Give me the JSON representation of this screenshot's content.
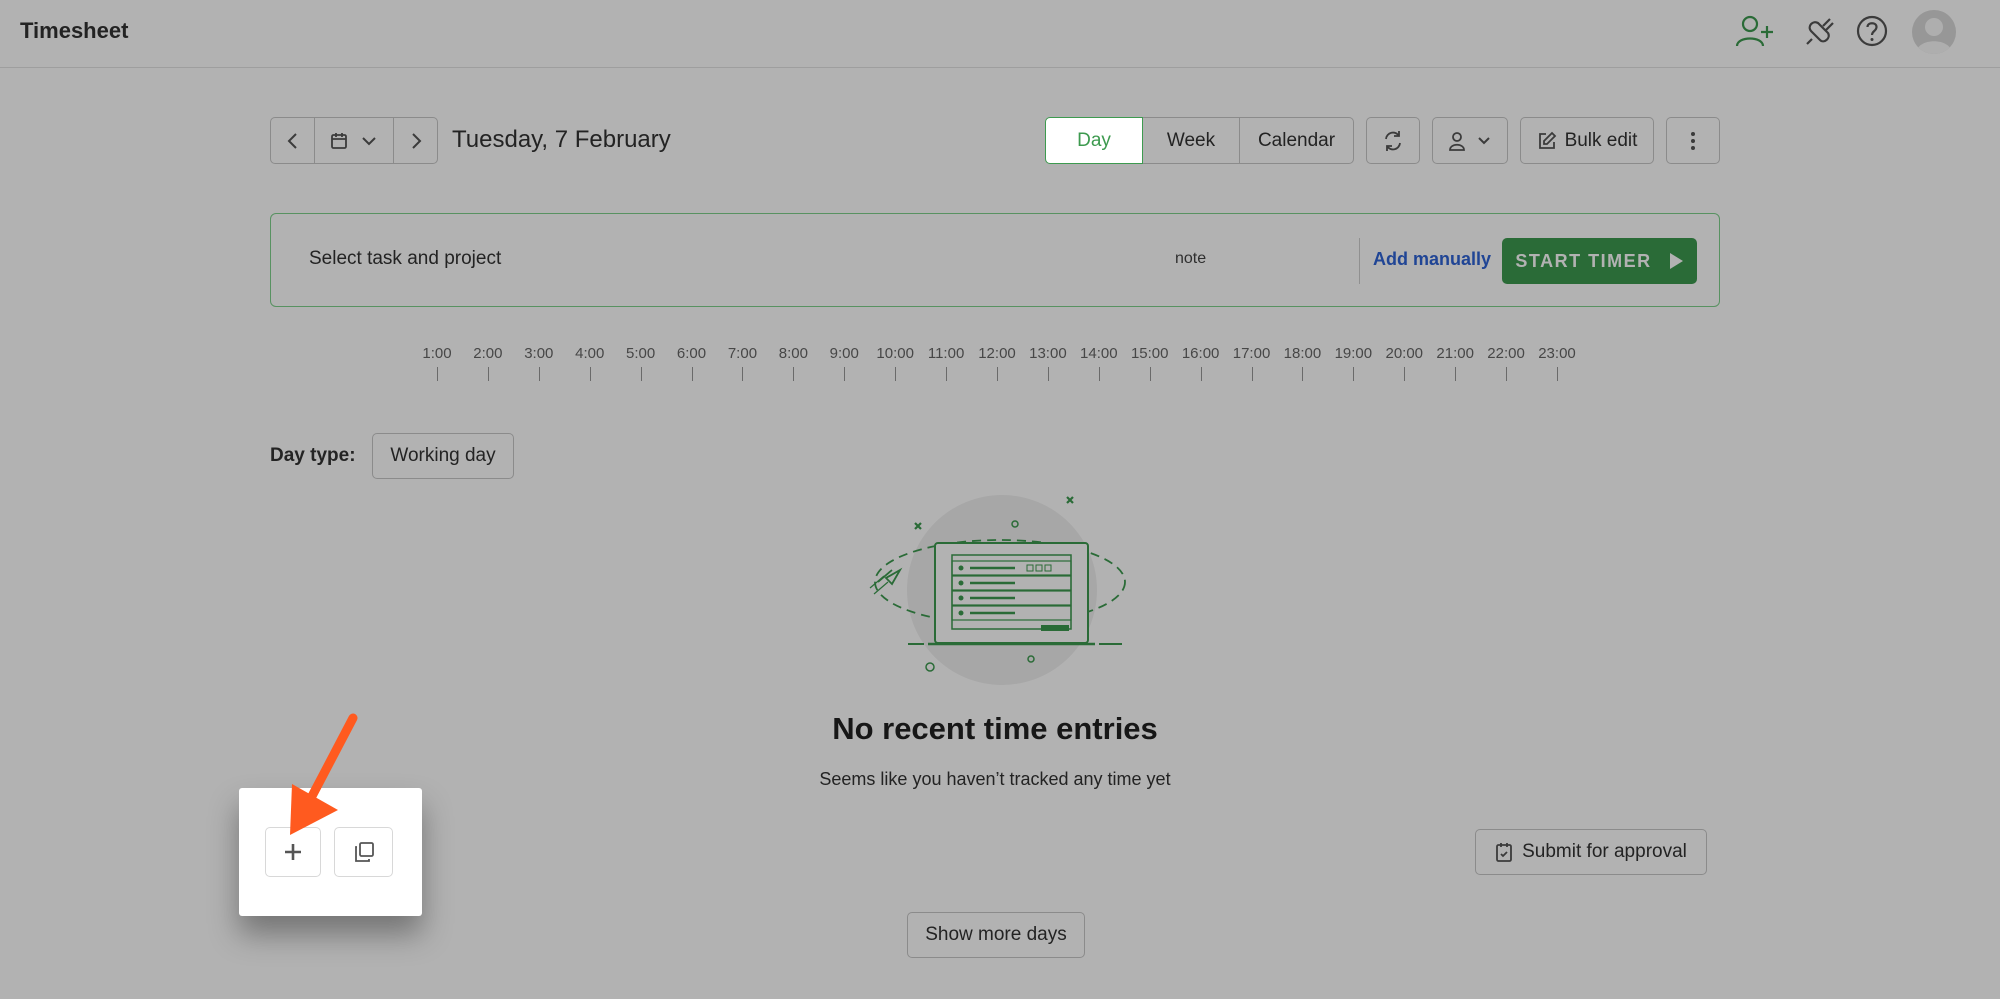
{
  "header": {
    "title": "Timesheet",
    "icons": [
      "add-user-icon",
      "plug-icon",
      "help-icon",
      "avatar"
    ]
  },
  "toolbar": {
    "date": "Tuesday, 7 February",
    "views": [
      "Day",
      "Week",
      "Calendar"
    ],
    "active_view": "Day",
    "bulk_edit": "Bulk edit"
  },
  "entry": {
    "task_placeholder": "Select task and project",
    "note_placeholder": "note",
    "add_manually": "Add manually",
    "start_timer": "START TIMER"
  },
  "timeline": {
    "hours": [
      "1:00",
      "2:00",
      "3:00",
      "4:00",
      "5:00",
      "6:00",
      "7:00",
      "8:00",
      "9:00",
      "10:00",
      "11:00",
      "12:00",
      "13:00",
      "14:00",
      "15:00",
      "16:00",
      "17:00",
      "18:00",
      "19:00",
      "20:00",
      "21:00",
      "22:00",
      "23:00"
    ]
  },
  "day_type": {
    "label": "Day type:",
    "value": "Working day"
  },
  "empty_state": {
    "title": "No recent time entries",
    "subtitle": "Seems like you haven’t tracked any time yet"
  },
  "actions": {
    "submit": "Submit for approval",
    "show_more": "Show more days"
  },
  "colors": {
    "accent": "#3d9a4f",
    "link": "#2f63d6",
    "arrow": "#ff5a1f"
  }
}
